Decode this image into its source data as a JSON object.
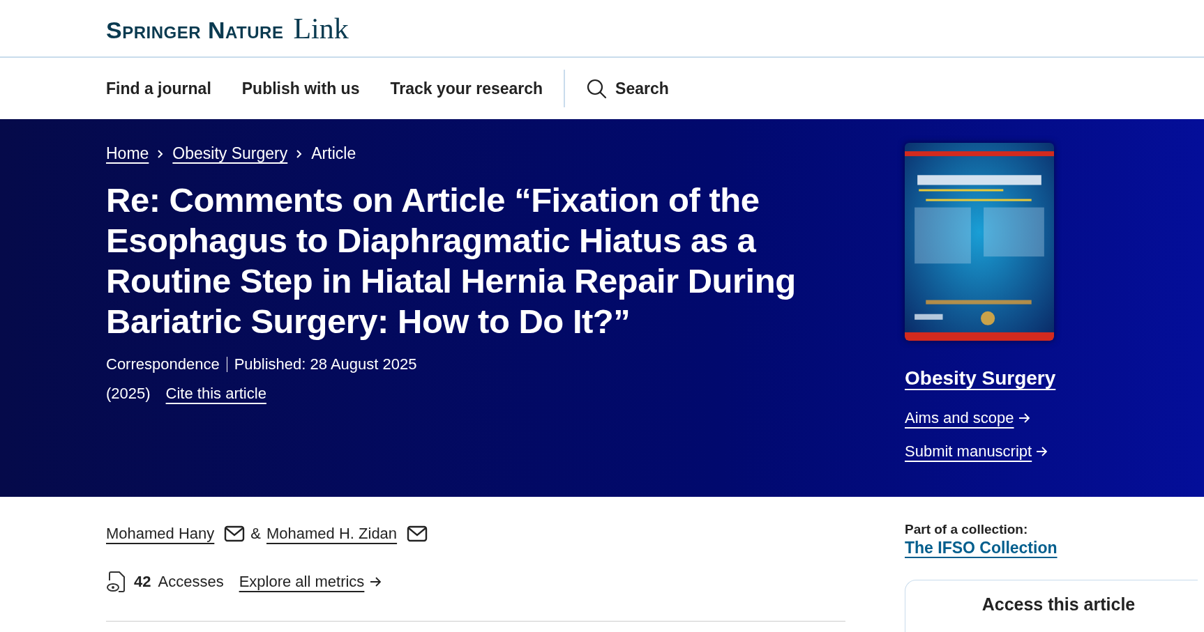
{
  "header": {
    "logo_brand": "Springer Nature",
    "logo_product": "Link"
  },
  "nav": {
    "items": [
      {
        "label": "Find a journal"
      },
      {
        "label": "Publish with us"
      },
      {
        "label": "Track your research"
      }
    ],
    "search": "Search"
  },
  "breadcrumbs": [
    {
      "label": "Home",
      "link": true
    },
    {
      "label": "Obesity Surgery",
      "link": true
    },
    {
      "label": "Article",
      "link": false
    }
  ],
  "article": {
    "title": "Re: Comments on Article “Fixation of the Esophagus to Diaphragmatic Hiatus as a Routine Step in Hiatal Hernia Repair During Bariatric Surgery: How to Do It?”",
    "type": "Correspondence",
    "published": "Published: 28 August 2025",
    "year": "(2025)",
    "cite": "Cite this article"
  },
  "journal": {
    "cover": {
      "kind": "picture"
    },
    "name": "Obesity Surgery",
    "links": [
      "Aims and scope",
      "Submit manuscript"
    ]
  },
  "authors": [
    {
      "name": "Mohamed Hany"
    },
    {
      "name": "Mohamed H. Zidan"
    }
  ],
  "author_separator": "&",
  "metrics": {
    "count": "42",
    "label": "Accesses",
    "link": "Explore all metrics"
  },
  "collection": {
    "label": "Part of a collection:",
    "name": "The IFSO Collection"
  },
  "access": {
    "title": "Access this article"
  }
}
